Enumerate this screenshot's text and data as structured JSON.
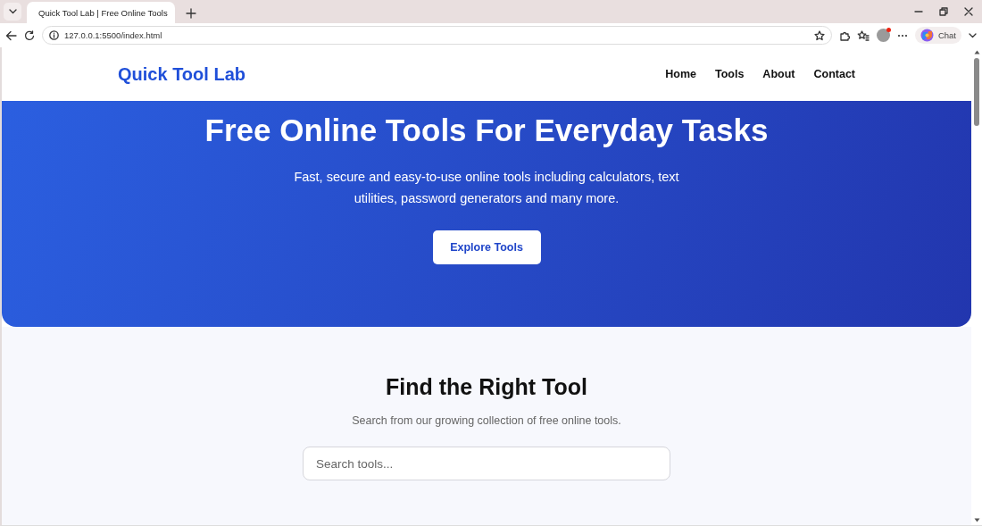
{
  "browser": {
    "tab_title": "Quick Tool Lab | Free Online Tools",
    "address": "127.0.0.1:5500/index.html",
    "chat_label": "Chat"
  },
  "header": {
    "logo": "Quick Tool Lab",
    "nav": [
      "Home",
      "Tools",
      "About",
      "Contact"
    ]
  },
  "hero": {
    "title": "Free Online Tools For Everyday Tasks",
    "text": "Fast, secure and easy-to-use online tools including calculators, text utilities, password generators and many more.",
    "button": "Explore Tools"
  },
  "search_section": {
    "title": "Find the Right Tool",
    "subtitle": "Search from our growing collection of free online tools.",
    "placeholder": "Search tools..."
  }
}
